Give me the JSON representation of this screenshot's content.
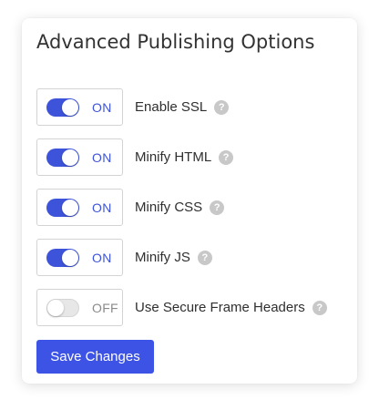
{
  "panel": {
    "title": "Advanced Publishing Options"
  },
  "colors": {
    "accent": "#3d53d9",
    "off_track": "#e7e7e7",
    "help_icon": "#c8c8c8"
  },
  "options": [
    {
      "label": "Enable SSL",
      "state": "ON",
      "enabled": true,
      "icon": "help-icon"
    },
    {
      "label": "Minify HTML",
      "state": "ON",
      "enabled": true,
      "icon": "help-icon"
    },
    {
      "label": "Minify CSS",
      "state": "ON",
      "enabled": true,
      "icon": "help-icon"
    },
    {
      "label": "Minify JS",
      "state": "ON",
      "enabled": true,
      "icon": "help-icon"
    },
    {
      "label": "Use Secure Frame Headers",
      "state": "OFF",
      "enabled": false,
      "icon": "help-icon"
    }
  ],
  "help_glyph": "?",
  "actions": {
    "save_label": "Save Changes"
  }
}
